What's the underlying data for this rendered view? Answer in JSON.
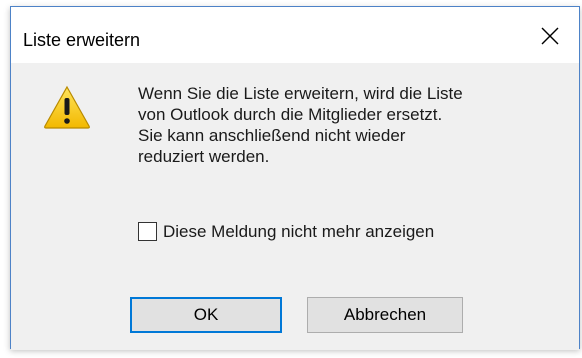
{
  "dialog": {
    "title": "Liste erweitern",
    "close_icon": "close-icon",
    "warning_icon": "warning-icon",
    "message": "Wenn Sie die Liste erweitern, wird die Liste\nvon Outlook durch die Mitglieder ersetzt.\nSie kann anschließend nicht wieder\nreduziert werden.",
    "checkbox_label": "Diese Meldung nicht mehr anzeigen",
    "checkbox_checked": false,
    "ok_label": "OK",
    "cancel_label": "Abbrechen"
  },
  "colors": {
    "dialog_border": "#4d82c7",
    "dialog_body": "#f0f0f0",
    "default_button_border": "#0078d7",
    "warning_yellow": "#f5c400"
  }
}
